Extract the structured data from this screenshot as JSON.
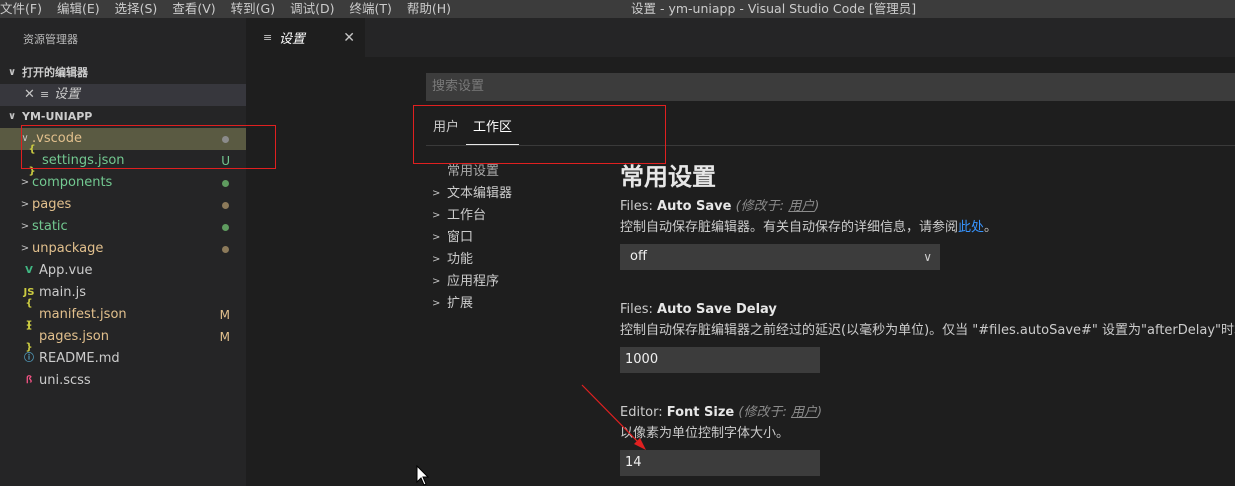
{
  "menu": [
    "文件(F)",
    "编辑(E)",
    "选择(S)",
    "查看(V)",
    "转到(G)",
    "调试(D)",
    "终端(T)",
    "帮助(H)"
  ],
  "window_title": "设置 - ym-uniapp - Visual Studio Code [管理员]",
  "sidebar": {
    "header": "资源管理器",
    "open_editors_label": "打开的编辑器",
    "open_editor_item": "设置",
    "project_label": "YM-UNIAPP",
    "tree": [
      {
        "name": ".vscode",
        "type": "folder",
        "expanded": true,
        "color": "#e2c08d",
        "status_dot": "#8b8b8b"
      },
      {
        "name": "settings.json",
        "type": "json",
        "color": "#73c991",
        "status": "U"
      },
      {
        "name": "components",
        "type": "folder",
        "color": "#73c991",
        "status_dot": "#5f9c5f"
      },
      {
        "name": "pages",
        "type": "folder",
        "color": "#e2c08d",
        "status_dot": "#8c7a5a"
      },
      {
        "name": "static",
        "type": "folder",
        "color": "#73c991",
        "status_dot": "#5f9c5f"
      },
      {
        "name": "unpackage",
        "type": "folder",
        "color": "#e2c08d",
        "status_dot": "#8c7a5a"
      },
      {
        "name": "App.vue",
        "type": "vue",
        "color": "#cccccc"
      },
      {
        "name": "main.js",
        "type": "js",
        "color": "#cccccc"
      },
      {
        "name": "manifest.json",
        "type": "json",
        "color": "#e2c08d",
        "status": "M"
      },
      {
        "name": "pages.json",
        "type": "json",
        "color": "#e2c08d",
        "status": "M"
      },
      {
        "name": "README.md",
        "type": "md",
        "color": "#cccccc"
      },
      {
        "name": "uni.scss",
        "type": "scss",
        "color": "#cccccc"
      }
    ]
  },
  "editor": {
    "tab_label": "设置",
    "search_placeholder": "搜索设置",
    "scope_tabs": [
      "用户",
      "工作区"
    ],
    "toc": [
      "常用设置",
      "文本编辑器",
      "工作台",
      "窗口",
      "功能",
      "应用程序",
      "扩展"
    ],
    "section_title": "常用设置",
    "settings": {
      "auto_save": {
        "prefix": "Files: ",
        "name": "Auto Save",
        "modified_prefix": "(修改于: ",
        "modified_scope": "用户",
        "modified_suffix": ")",
        "desc": "控制自动保存脏编辑器。有关自动保存的详细信息，请参阅",
        "link": "此处",
        "desc_end": "。",
        "value": "off"
      },
      "auto_save_delay": {
        "prefix": "Files: ",
        "name": "Auto Save Delay",
        "desc": "控制自动保存脏编辑器之前经过的延迟(以毫秒为单位)。仅当 \"#files.autoSave#\" 设置为\"afterDelay\"时才适用",
        "value": "1000"
      },
      "font_size": {
        "prefix": "Editor: ",
        "name": "Font Size",
        "modified_prefix": "(修改于: ",
        "modified_scope": "用户",
        "modified_suffix": ")",
        "desc": "以像素为单位控制字体大小。",
        "value": "14"
      }
    }
  },
  "colors": {
    "annotation_red": "#e02020",
    "link_blue": "#3794ff"
  }
}
